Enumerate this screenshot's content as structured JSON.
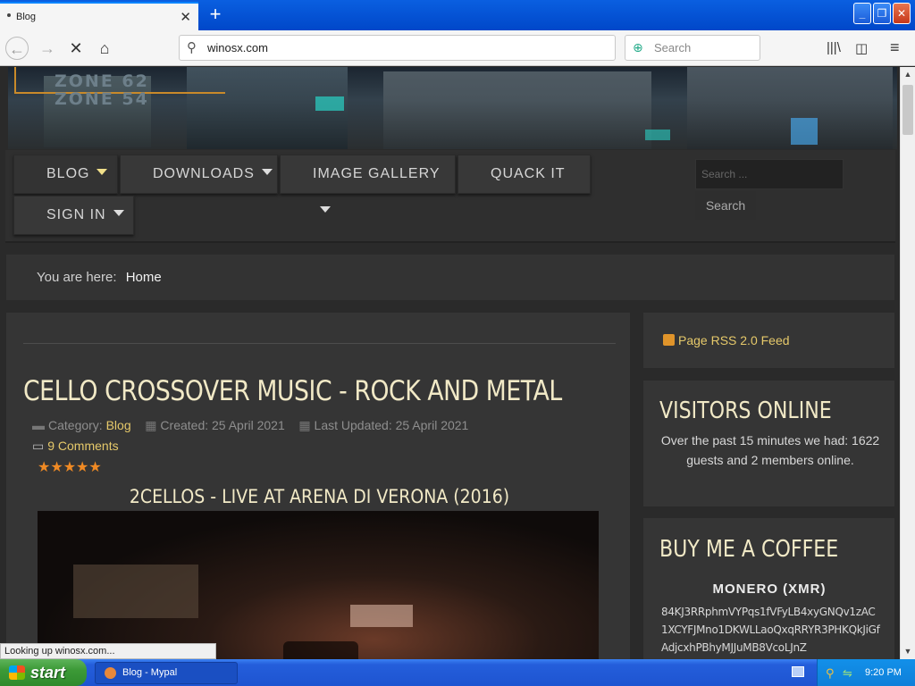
{
  "browser": {
    "tab_title": "Blog",
    "url": "winosx.com",
    "search_placeholder": "Search",
    "status_text": "Looking up winosx.com..."
  },
  "site": {
    "nav": {
      "blog": "BLOG",
      "downloads": "DOWNLOADS",
      "image_gallery": "IMAGE GALLERY",
      "quack_it": "QUACK IT",
      "sign_in": "SIGN IN"
    },
    "search_placeholder": "Search ...",
    "search_button": "Search",
    "banner_logo_lines": [
      "ZONE 62",
      "ZONE 54"
    ],
    "breadcrumb": {
      "prefix": "You are here:",
      "current": "Home"
    }
  },
  "article": {
    "title": "CELLO CROSSOVER MUSIC - ROCK AND METAL",
    "category_label": "Category:",
    "category": "Blog",
    "created": "Created: 25 April 2021",
    "updated": "Last Updated: 25 April 2021",
    "comments": "9 Comments",
    "rating_stars": 5,
    "rating_display": "★★★★★",
    "video_title": "2CELLOS - LIVE AT ARENA DI VERONA (2016)"
  },
  "sidebar": {
    "rss": "Page RSS 2.0 Feed",
    "visitors_title": "VISITORS ONLINE",
    "visitors_text": "Over the past 15 minutes we had: 1622 guests and 2 members online.",
    "coffee_title": "BUY ME A COFFEE",
    "coffee_sub": "MONERO (XMR)",
    "coffee_address": "84KJ3RRphmVYPqs1fVFyLB4xyGNQv1zAC1XCYFJMno1DKWLLaoQxqRRYR3PHKQkJiGfAdjcxhPBhyMJJuMB8VcoLJnZ"
  },
  "taskbar": {
    "start": "start",
    "task_item": "Blog - Mypal",
    "clock": "9:20 PM"
  },
  "colors": {
    "accent_gold": "#e6c96a",
    "title_cream": "#f1e9c6",
    "star_orange": "#f08a24",
    "xp_blue": "#245edb"
  }
}
